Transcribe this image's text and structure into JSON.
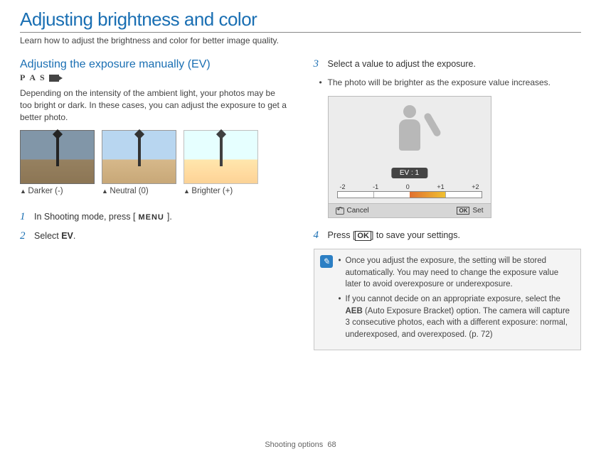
{
  "page": {
    "title": "Adjusting brightness and color",
    "subtitle": "Learn how to adjust the brightness and color for better image quality."
  },
  "left": {
    "heading": "Adjusting the exposure manually (EV)",
    "modes": {
      "p": "P",
      "a": "A",
      "s": "S"
    },
    "intro": "Depending on the intensity of the ambient light, your photos may be too bright or dark. In these cases, you can adjust the exposure to get a better photo.",
    "thumbs": {
      "darker": "Darker (-)",
      "neutral": "Neutral (0)",
      "brighter": "Brighter (+)"
    },
    "step1_num": "1",
    "step1_a": "In Shooting mode, press [",
    "step1_menu": "MENU",
    "step1_b": "].",
    "step2_num": "2",
    "step2_a": "Select ",
    "step2_ev": "EV",
    "step2_b": "."
  },
  "right": {
    "step3_num": "3",
    "step3": "Select a value to adjust the exposure.",
    "step3_sub": "The photo will be brighter as the exposure value increases.",
    "ev_screen": {
      "badge": "EV : 1",
      "ticks": {
        "m2": "-2",
        "m1": "-1",
        "z": "0",
        "p1": "+1",
        "p2": "+2"
      },
      "cancel": "Cancel",
      "set": "Set"
    },
    "step4_num": "4",
    "step4_a": "Press [",
    "step4_ok": "OK",
    "step4_b": "] to save your settings.",
    "note": {
      "bullet1": "Once you adjust the exposure, the setting will be stored automatically. You may need to change the exposure value later to avoid overexposure or underexposure.",
      "bullet2_a": "If you cannot decide on an appropriate exposure, select the ",
      "bullet2_aeb": "AEB",
      "bullet2_b": " (Auto Exposure Bracket) option. The camera will capture 3 consecutive photos, each with a different exposure: normal, underexposed, and overexposed. (p. 72)"
    }
  },
  "footer": {
    "section": "Shooting options",
    "page_num": "68"
  }
}
